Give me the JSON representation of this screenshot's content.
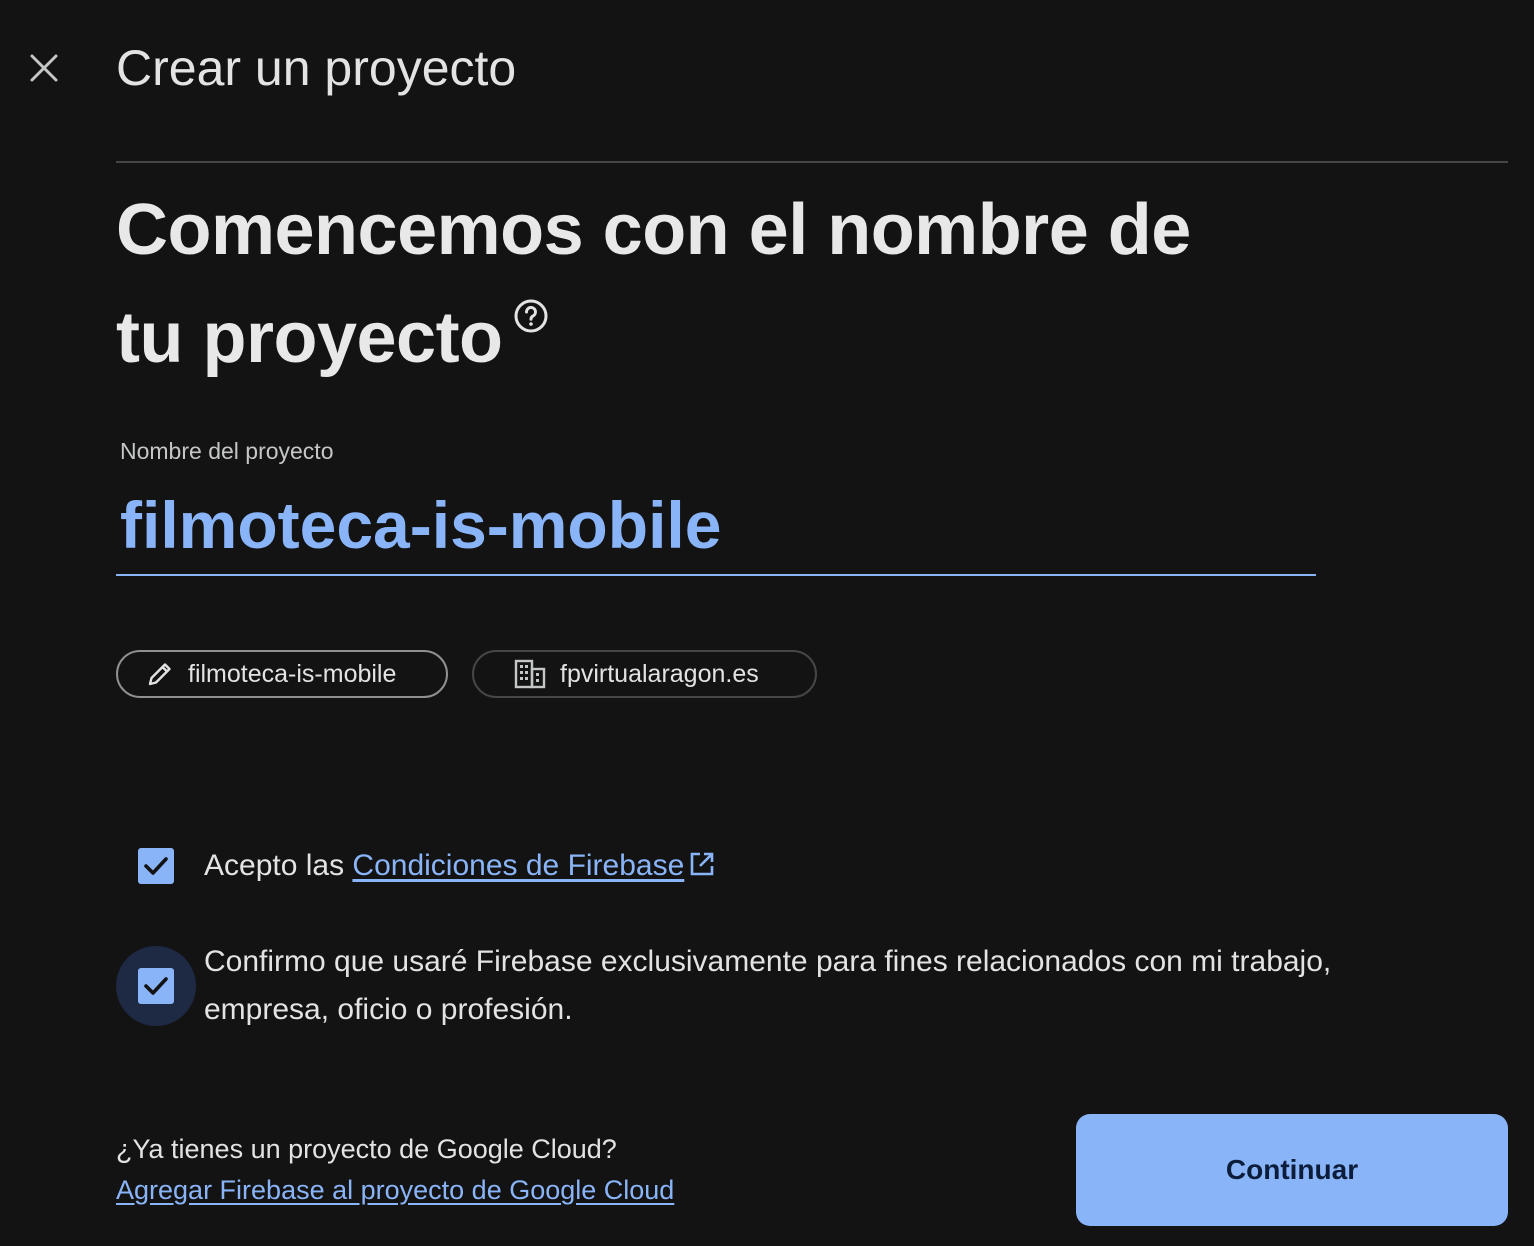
{
  "dialog": {
    "title": "Crear un proyecto",
    "close_icon": "close-icon"
  },
  "step": {
    "heading": "Comencemos con el nombre de tu proyecto",
    "help_icon": "help-circle-icon"
  },
  "project_name_field": {
    "label": "Nombre del proyecto",
    "value": "filmoteca-is-mobile"
  },
  "chips": {
    "project_id": {
      "icon": "pencil-icon",
      "label": "filmoteca-is-mobile"
    },
    "organization": {
      "icon": "building-icon",
      "label": "fpvirtualaragon.es"
    }
  },
  "consents": {
    "terms": {
      "checked": true,
      "prefix": "Acepto las ",
      "link_text": "Condiciones de Firebase",
      "link_icon": "external-link-icon"
    },
    "usage": {
      "checked": true,
      "text": "Confirmo que usaré Firebase exclusivamente para fines relacionados con mi trabajo, empresa, oficio o profesión."
    }
  },
  "footer": {
    "question": "¿Ya tienes un proyecto de Google Cloud?",
    "link_text": "Agregar Firebase al proyecto de Google Cloud",
    "continue_label": "Continuar"
  },
  "colors": {
    "background": "#131314",
    "accent": "#8ab4f8",
    "text": "#e3e3e3"
  }
}
